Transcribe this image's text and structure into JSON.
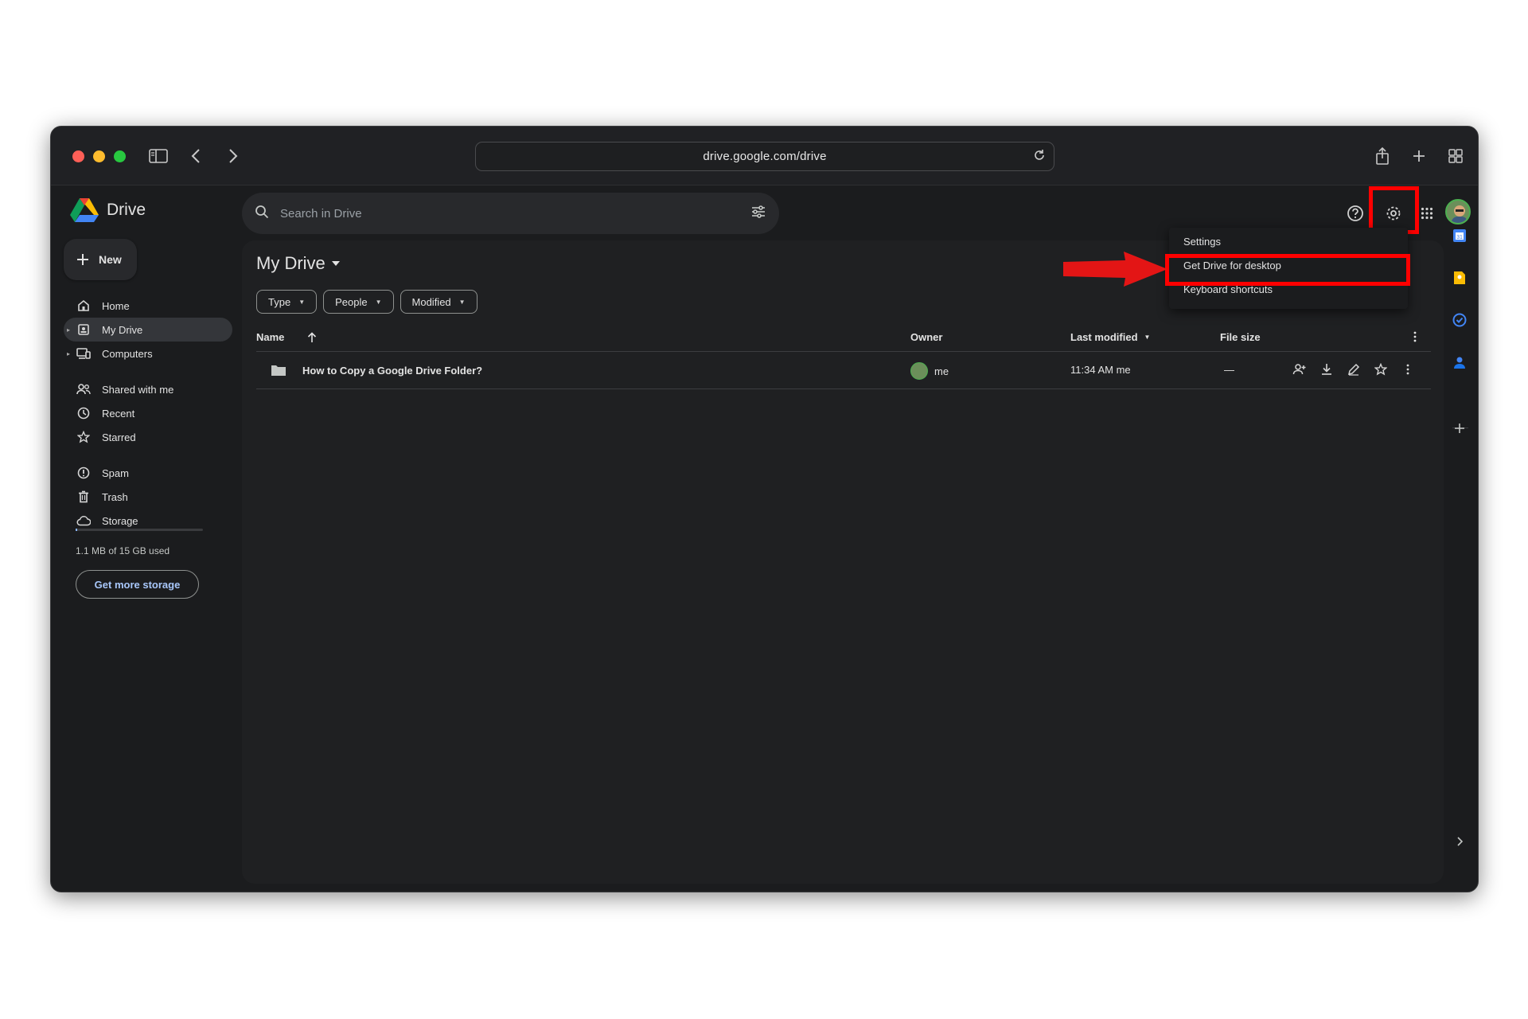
{
  "browser": {
    "url": "drive.google.com/drive"
  },
  "app": {
    "brand": "Drive",
    "search_placeholder": "Search in Drive"
  },
  "sidebar": {
    "new_label": "New",
    "items": [
      {
        "label": "Home"
      },
      {
        "label": "My Drive"
      },
      {
        "label": "Computers"
      },
      {
        "label": "Shared with me"
      },
      {
        "label": "Recent"
      },
      {
        "label": "Starred"
      },
      {
        "label": "Spam"
      },
      {
        "label": "Trash"
      },
      {
        "label": "Storage"
      }
    ],
    "storage_text": "1.1 MB of 15 GB used",
    "storage_used_fraction": 0.0001,
    "storage_button": "Get more storage"
  },
  "main": {
    "title": "My Drive",
    "filters": [
      "Type",
      "People",
      "Modified"
    ],
    "columns": {
      "name": "Name",
      "owner": "Owner",
      "last_modified": "Last modified",
      "file_size": "File size"
    },
    "rows": [
      {
        "name": "How to Copy a Google Drive Folder?",
        "owner": "me",
        "modified": "11:34 AM me",
        "size": "—"
      }
    ]
  },
  "settings_menu": {
    "items": [
      "Settings",
      "Get Drive for desktop",
      "Keyboard shortcuts"
    ]
  },
  "colors": {
    "background": "#1b1c1e",
    "highlight": "#ff0000",
    "accent": "#a8c7fa"
  }
}
